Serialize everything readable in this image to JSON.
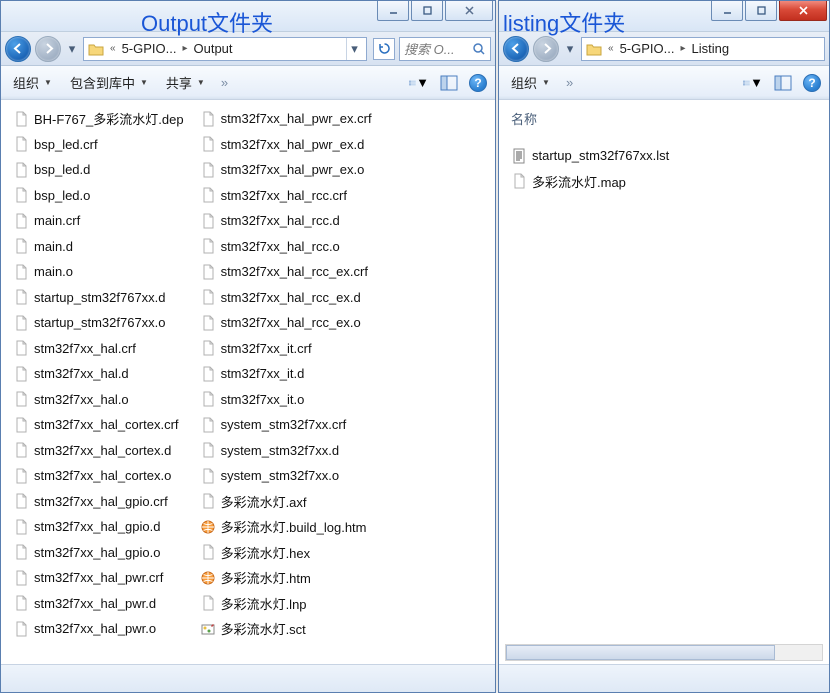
{
  "annotations": {
    "left": "Output文件夹",
    "right": "listing文件夹"
  },
  "left": {
    "titlebar": {
      "min": "min",
      "max": "max",
      "close": "close"
    },
    "addr": {
      "parent": "5-GPIO...",
      "current": "Output",
      "search_ph": "搜索 O..."
    },
    "toolbar": {
      "org": "组织",
      "inc": "包含到库中",
      "share": "共享"
    },
    "files_col1": [
      {
        "n": "BH-F767_多彩流水灯.dep",
        "t": "file"
      },
      {
        "n": "bsp_led.crf",
        "t": "file"
      },
      {
        "n": "bsp_led.d",
        "t": "file"
      },
      {
        "n": "bsp_led.o",
        "t": "file"
      },
      {
        "n": "main.crf",
        "t": "file"
      },
      {
        "n": "main.d",
        "t": "file"
      },
      {
        "n": "main.o",
        "t": "file"
      },
      {
        "n": "startup_stm32f767xx.d",
        "t": "file"
      },
      {
        "n": "startup_stm32f767xx.o",
        "t": "file"
      },
      {
        "n": "stm32f7xx_hal.crf",
        "t": "file"
      },
      {
        "n": "stm32f7xx_hal.d",
        "t": "file"
      },
      {
        "n": "stm32f7xx_hal.o",
        "t": "file"
      },
      {
        "n": "stm32f7xx_hal_cortex.crf",
        "t": "file"
      },
      {
        "n": "stm32f7xx_hal_cortex.d",
        "t": "file"
      },
      {
        "n": "stm32f7xx_hal_cortex.o",
        "t": "file"
      },
      {
        "n": "stm32f7xx_hal_gpio.crf",
        "t": "file"
      },
      {
        "n": "stm32f7xx_hal_gpio.d",
        "t": "file"
      },
      {
        "n": "stm32f7xx_hal_gpio.o",
        "t": "file"
      },
      {
        "n": "stm32f7xx_hal_pwr.crf",
        "t": "file"
      },
      {
        "n": "stm32f7xx_hal_pwr.d",
        "t": "file"
      },
      {
        "n": "stm32f7xx_hal_pwr.o",
        "t": "file"
      }
    ],
    "files_col2": [
      {
        "n": "stm32f7xx_hal_pwr_ex.crf",
        "t": "file"
      },
      {
        "n": "stm32f7xx_hal_pwr_ex.d",
        "t": "file"
      },
      {
        "n": "stm32f7xx_hal_pwr_ex.o",
        "t": "file"
      },
      {
        "n": "stm32f7xx_hal_rcc.crf",
        "t": "file"
      },
      {
        "n": "stm32f7xx_hal_rcc.d",
        "t": "file"
      },
      {
        "n": "stm32f7xx_hal_rcc.o",
        "t": "file"
      },
      {
        "n": "stm32f7xx_hal_rcc_ex.crf",
        "t": "file"
      },
      {
        "n": "stm32f7xx_hal_rcc_ex.d",
        "t": "file"
      },
      {
        "n": "stm32f7xx_hal_rcc_ex.o",
        "t": "file"
      },
      {
        "n": "stm32f7xx_it.crf",
        "t": "file"
      },
      {
        "n": "stm32f7xx_it.d",
        "t": "file"
      },
      {
        "n": "stm32f7xx_it.o",
        "t": "file"
      },
      {
        "n": "system_stm32f7xx.crf",
        "t": "file"
      },
      {
        "n": "system_stm32f7xx.d",
        "t": "file"
      },
      {
        "n": "system_stm32f7xx.o",
        "t": "file"
      },
      {
        "n": "多彩流水灯.axf",
        "t": "file"
      },
      {
        "n": "多彩流水灯.build_log.htm",
        "t": "htm"
      },
      {
        "n": "多彩流水灯.hex",
        "t": "file"
      },
      {
        "n": "多彩流水灯.htm",
        "t": "htm"
      },
      {
        "n": "多彩流水灯.lnp",
        "t": "file"
      },
      {
        "n": "多彩流水灯.sct",
        "t": "sct"
      }
    ]
  },
  "right": {
    "addr": {
      "parent": "5-GPIO...",
      "current": "Listing"
    },
    "toolbar": {
      "org": "组织"
    },
    "col_head": "名称",
    "files": [
      {
        "n": "startup_stm32f767xx.lst",
        "t": "lst"
      },
      {
        "n": "多彩流水灯.map",
        "t": "file"
      }
    ]
  }
}
